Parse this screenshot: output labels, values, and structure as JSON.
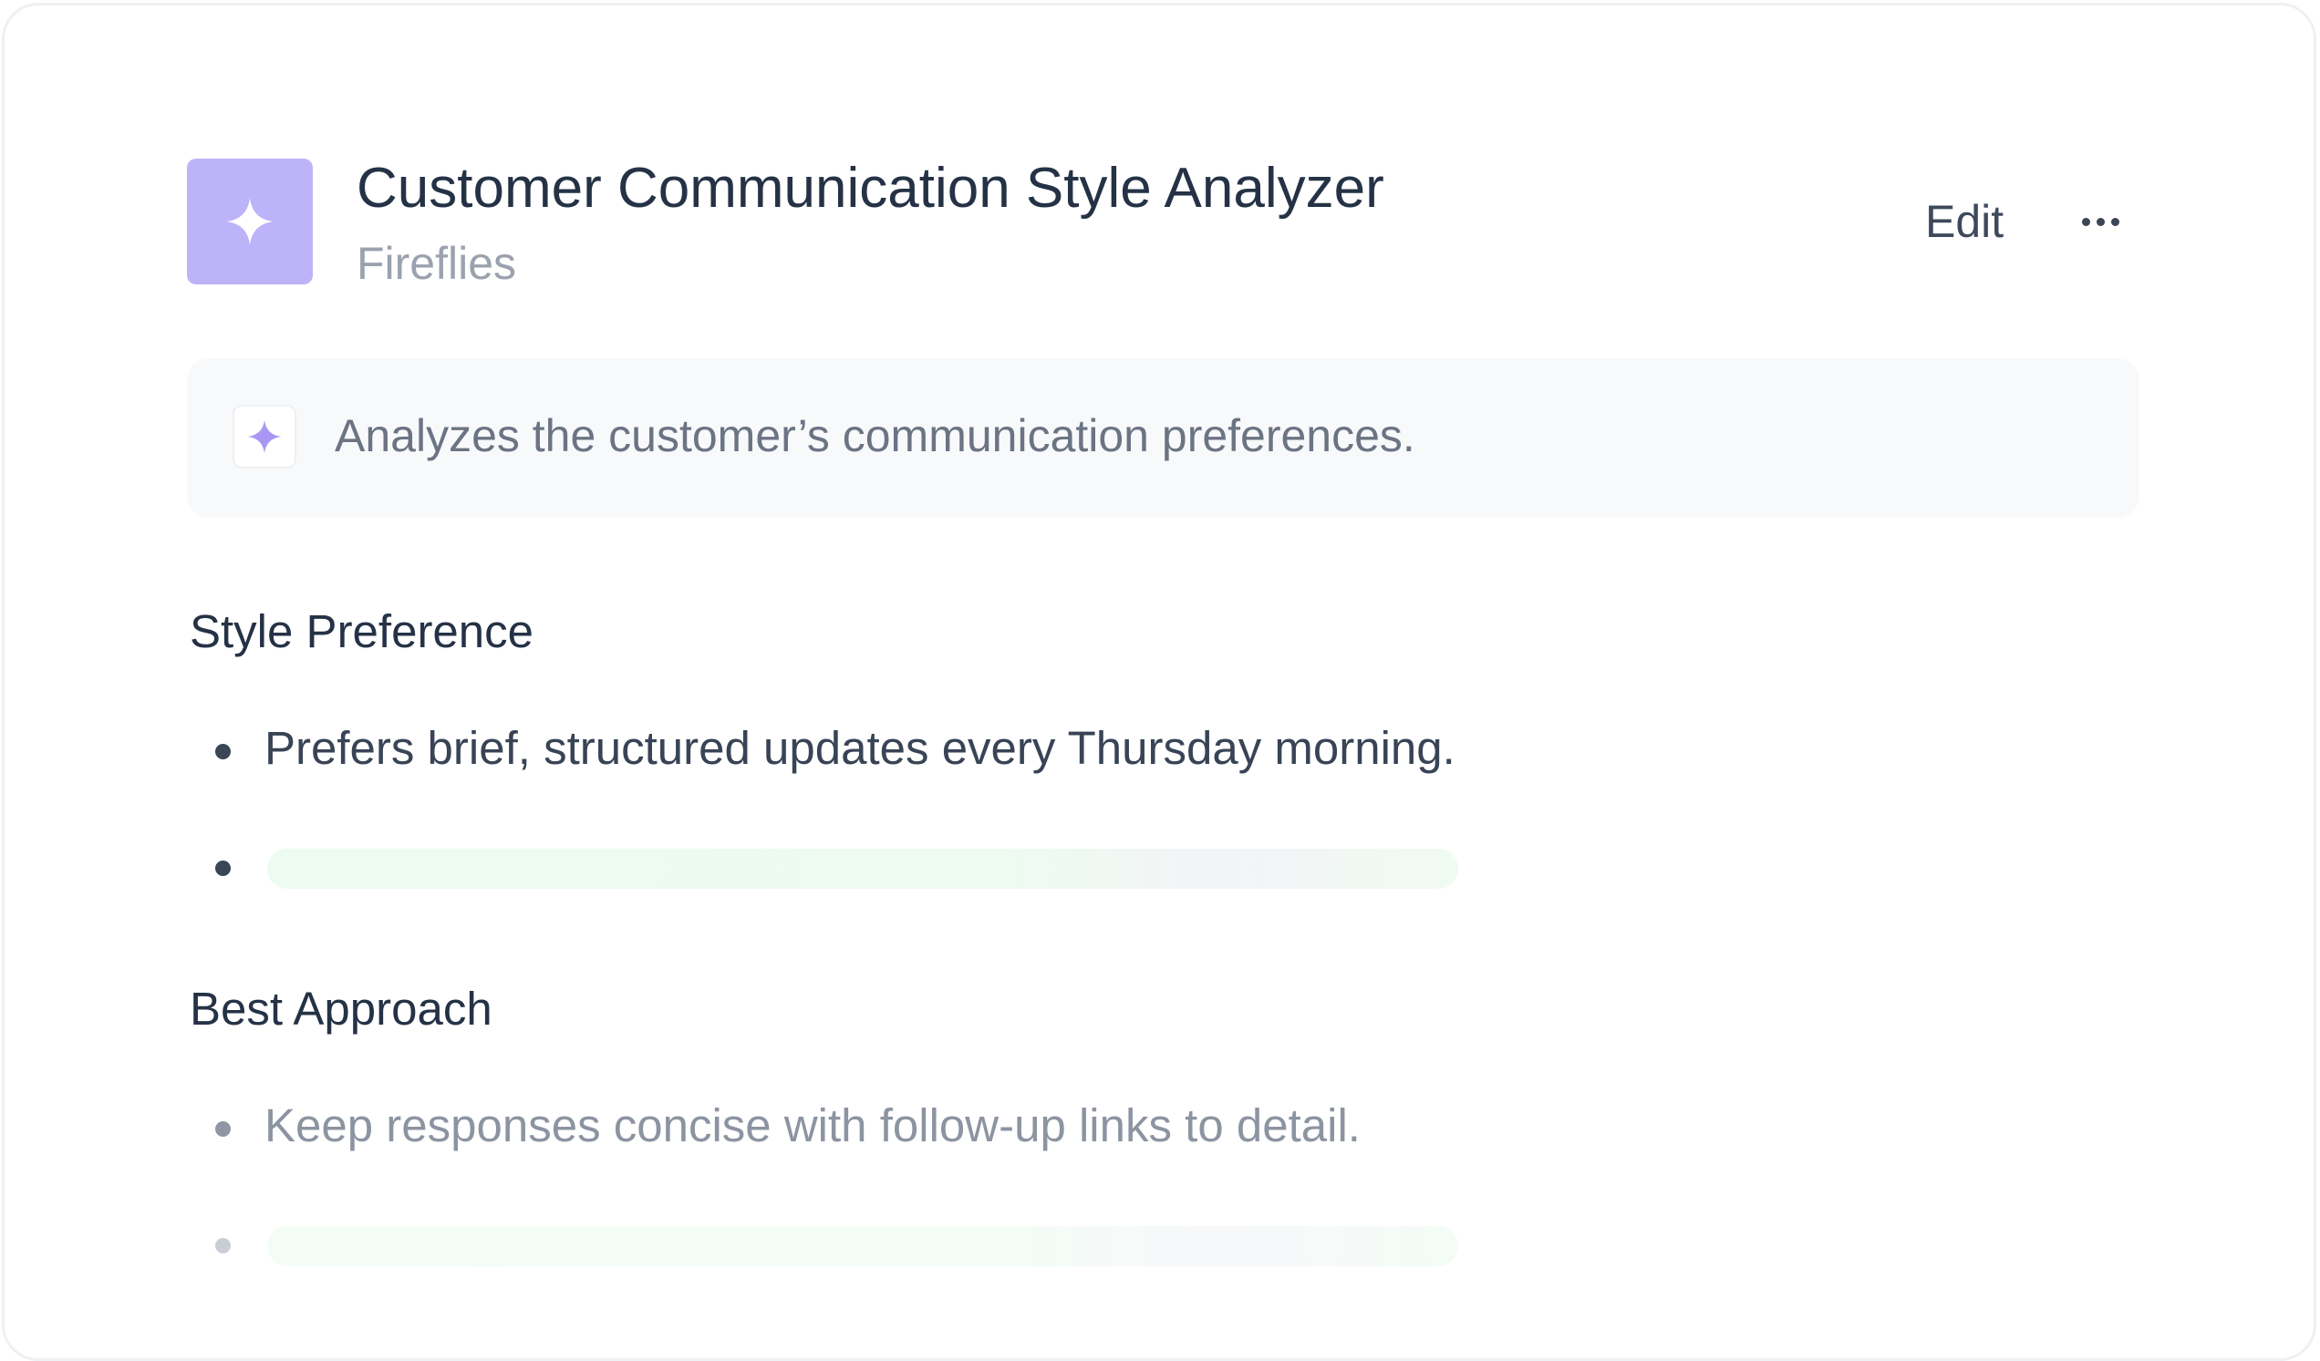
{
  "header": {
    "title": "Customer Communication Style Analyzer",
    "subtitle": "Fireflies",
    "edit_label": "Edit",
    "app_icon": "sparkle-icon",
    "more_icon": "more-horizontal-icon"
  },
  "description": {
    "icon": "sparkle-icon",
    "text": "Analyzes the customer’s communication preferences."
  },
  "sections": [
    {
      "title": "Style Preference",
      "items": [
        {
          "text": "Prefers brief, structured updates every Thursday morning.",
          "loading": false
        },
        {
          "text": "",
          "loading": true
        }
      ]
    },
    {
      "title": "Best Approach",
      "items": [
        {
          "text": "Keep responses concise with follow-up links to detail.",
          "loading": false
        },
        {
          "text": "",
          "loading": true
        }
      ]
    }
  ],
  "colors": {
    "accent": "#bdb3f9",
    "accent_icon": "#a997f5",
    "text_primary": "#253246",
    "text_muted": "#9aa2ae",
    "skeleton": "#ecfcf1"
  }
}
